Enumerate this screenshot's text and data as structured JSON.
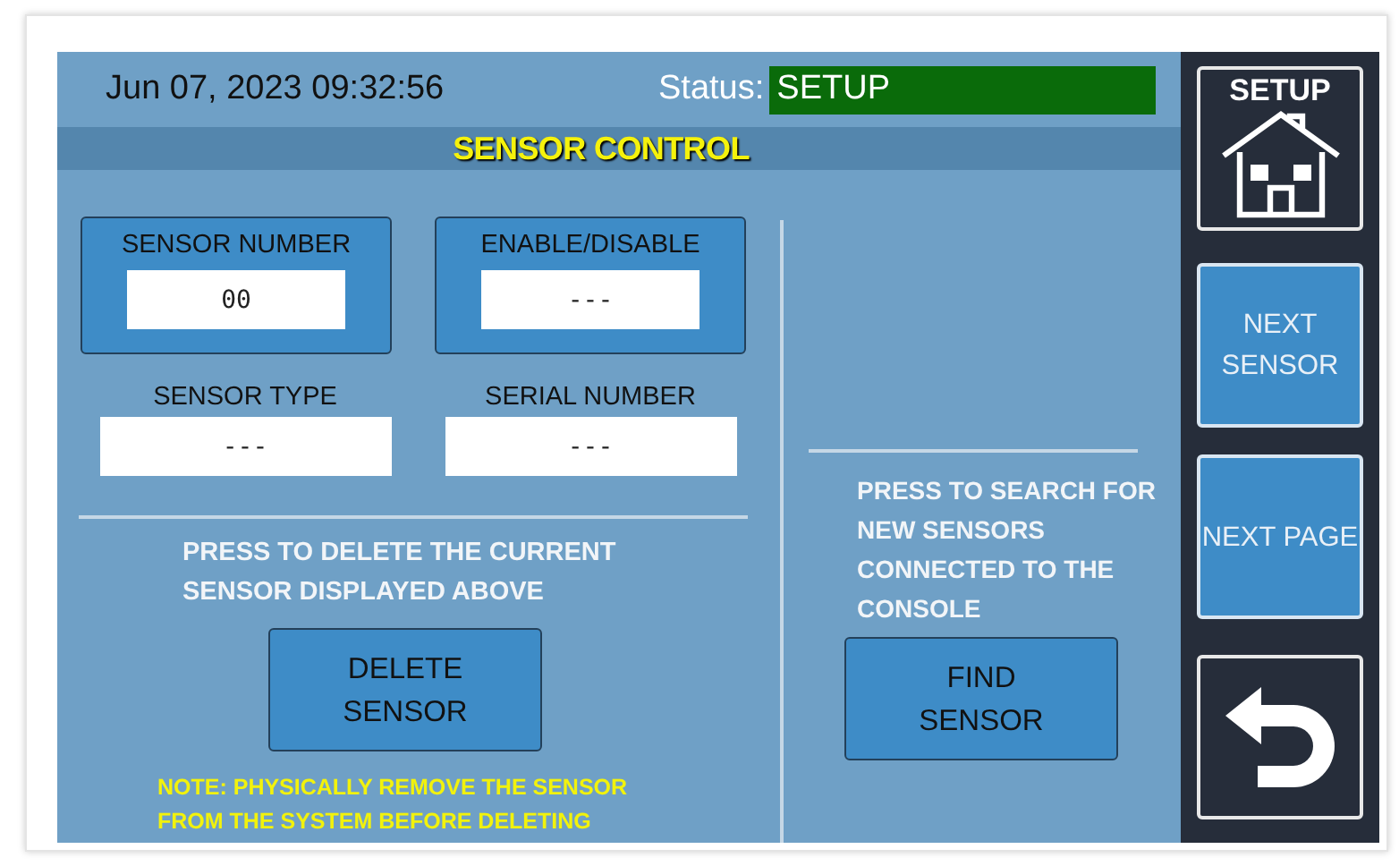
{
  "datetime": "Jun 07, 2023 09:32:56",
  "status": {
    "label": "Status:",
    "value": "SETUP"
  },
  "title": "SENSOR CONTROL",
  "fields": [
    {
      "label": "SENSOR NUMBER",
      "value": "00",
      "kind": "framed"
    },
    {
      "label": "ENABLE/DISABLE",
      "value": "---",
      "kind": "framed"
    },
    {
      "label": "SENSOR TYPE",
      "value": "---",
      "kind": "plain"
    },
    {
      "label": "SERIAL NUMBER",
      "value": "---",
      "kind": "plain"
    }
  ],
  "delete_section": {
    "instruction": "PRESS TO DELETE THE CURRENT SENSOR DISPLAYED ABOVE",
    "button": "DELETE SENSOR",
    "note": "NOTE: PHYSICALLY REMOVE THE SENSOR FROM THE SYSTEM BEFORE DELETING"
  },
  "find_section": {
    "instruction": "PRESS TO SEARCH FOR NEW SENSORS CONNECTED TO THE CONSOLE",
    "button": "FIND SENSOR"
  },
  "sidebar": [
    {
      "kind": "home",
      "label": "SETUP"
    },
    {
      "kind": "text",
      "label": "NEXT SENSOR"
    },
    {
      "kind": "text",
      "label": "NEXT PAGE"
    },
    {
      "kind": "back"
    }
  ]
}
